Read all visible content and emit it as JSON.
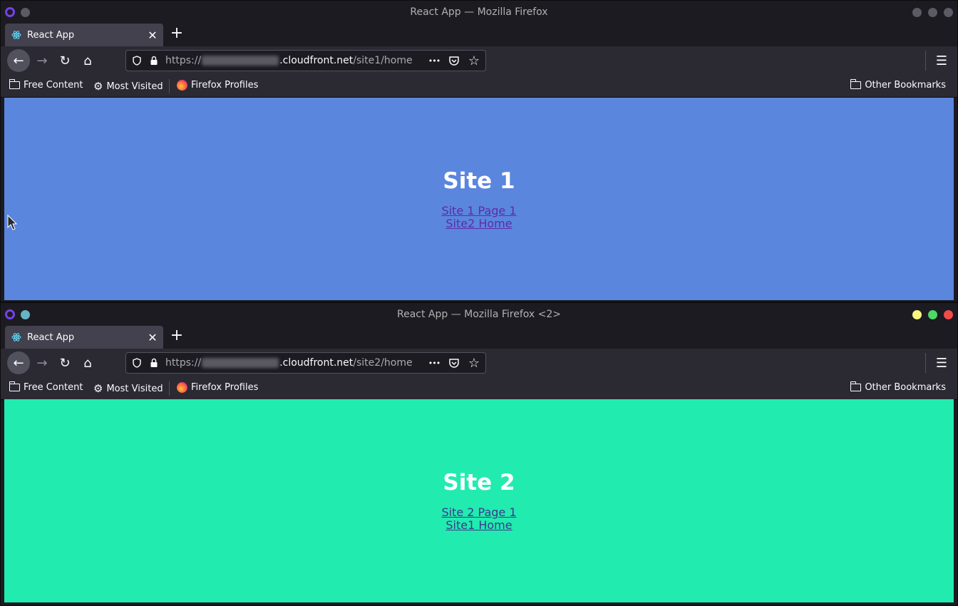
{
  "windows": [
    {
      "title": "React App — Mozilla Firefox",
      "tab": {
        "title": "React App",
        "close": "✕"
      },
      "newtab": "+",
      "url": {
        "scheme": "https://",
        "host": ".cloudfront.net",
        "path": "/site1/home"
      },
      "bookmarks": {
        "free_content": "Free Content",
        "most_visited": "Most Visited",
        "firefox_profiles": "Firefox Profiles",
        "other_bookmarks": "Other Bookmarks"
      },
      "page": {
        "heading": "Site 1",
        "links": [
          "Site 1 Page 1",
          "Site2 Home"
        ]
      },
      "colors": {
        "background": "#5b86de",
        "link": "#5a2da8",
        "window_buttons": [
          "#5b5b66",
          "#5b5b66",
          "#5b5b66"
        ]
      }
    },
    {
      "title": "React App — Mozilla Firefox <2>",
      "tab": {
        "title": "React App",
        "close": "✕"
      },
      "newtab": "+",
      "url": {
        "scheme": "https://",
        "host": ".cloudfront.net",
        "path": "/site2/home"
      },
      "bookmarks": {
        "free_content": "Free Content",
        "most_visited": "Most Visited",
        "firefox_profiles": "Firefox Profiles",
        "other_bookmarks": "Other Bookmarks"
      },
      "page": {
        "heading": "Site 2",
        "links": [
          "Site 2 Page 1",
          "Site1 Home"
        ]
      },
      "colors": {
        "background": "#22ebb0",
        "link": "#3b3a8c",
        "window_buttons": [
          "#f8f57f",
          "#4cd964",
          "#f24a4a"
        ]
      }
    }
  ],
  "icons": {
    "back": "arrow-left-icon",
    "forward": "arrow-right-icon",
    "reload": "reload-icon",
    "home": "home-icon",
    "shield": "tracking-shield-icon",
    "lock": "lock-icon",
    "more": "more-icon",
    "pocket": "pocket-icon",
    "star": "star-icon",
    "menu": "hamburger-menu-icon"
  },
  "glyphs": {
    "back": "←",
    "forward": "→",
    "reload": "↻",
    "home": "⌂",
    "more": "•••",
    "star": "☆",
    "menu": "☰",
    "gear": "⚙"
  }
}
